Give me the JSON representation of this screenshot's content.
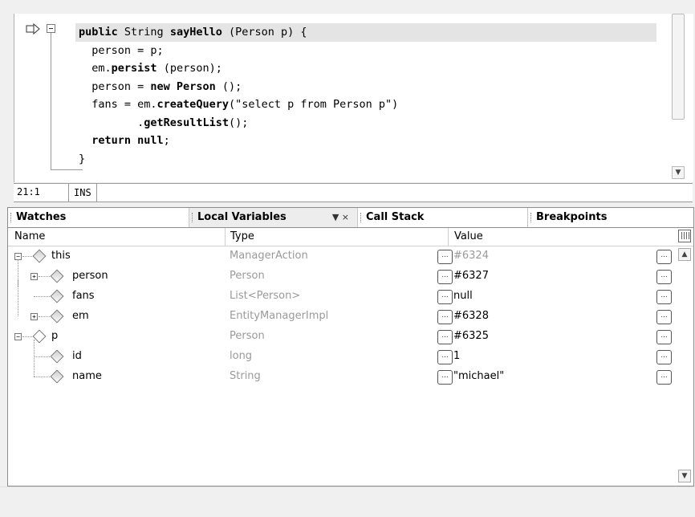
{
  "editor": {
    "lines": [
      {
        "kw": "public",
        "text": " String ",
        "bold2": "sayHello",
        "rest": " (Person p) {"
      },
      "person = p;",
      {
        "pre": "em.",
        "b": "persist",
        "rest": " (person);"
      },
      {
        "pre": "person = ",
        "b": "new Person",
        "rest": " ();"
      },
      {
        "pre": "fans = em.",
        "b": "createQuery",
        "rest": "(\"select p from Person p\")"
      },
      {
        "pre": "       .",
        "b": "getResultList",
        "rest": "();"
      },
      {
        "b": "return null",
        "rest": ";"
      },
      "}"
    ],
    "l0_kw": "public",
    "l0_text": " String ",
    "l0_name": "sayHello",
    "l0_rest": " (Person p) {",
    "l1": "person = p;",
    "l2_pre": "em.",
    "l2_b": "persist",
    "l2_rest": " (person);",
    "l3_pre": "person = ",
    "l3_b": "new Person",
    "l3_rest": " ();",
    "l4_pre": "fans = em.",
    "l4_b": "createQuery",
    "l4_rest": "(\"select p from Person p\")",
    "l5_pre": "       .",
    "l5_b": "getResultList",
    "l5_rest": "();",
    "l6_b": "return null",
    "l6_rest": ";",
    "l7": "}"
  },
  "status": {
    "position": "21:1",
    "mode": "INS"
  },
  "tabs": [
    {
      "label": "Watches"
    },
    {
      "label": "Local Variables",
      "controls": "▼ ×"
    },
    {
      "label": "Call Stack"
    },
    {
      "label": "Breakpoints"
    }
  ],
  "columns": {
    "name": "Name",
    "type": "Type",
    "value": "Value"
  },
  "rows": [
    {
      "name": "this",
      "type": "ManagerAction",
      "value": "#6324"
    },
    {
      "name": "person",
      "type": "Person",
      "value": "#6327"
    },
    {
      "name": "fans",
      "type": "List<Person>",
      "value": "null"
    },
    {
      "name": "em",
      "type": "EntityManagerImpl",
      "value": "#6328"
    },
    {
      "name": "p",
      "type": "Person",
      "value": "#6325"
    },
    {
      "name": "id",
      "type": "long",
      "value": "1"
    },
    {
      "name": "name",
      "type": "String",
      "value": "\"michael\""
    }
  ],
  "ellipsis": "...",
  "icons": [
    "current-line-arrow-icon",
    "fold-icon",
    "expand-icon",
    "collapse-icon",
    "field-icon",
    "customize-columns-icon"
  ]
}
